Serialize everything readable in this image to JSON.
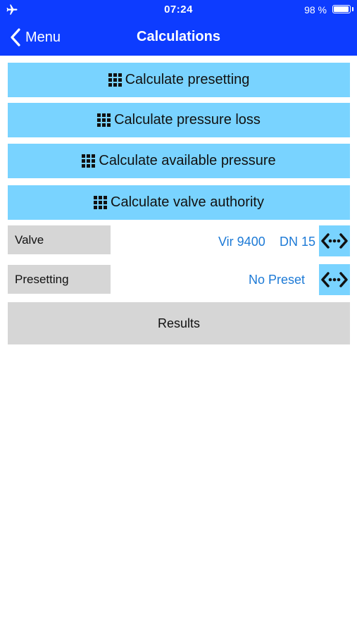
{
  "status": {
    "time": "07:24",
    "battery": "98 %",
    "battery_level": 0.98,
    "airplane_icon": "airplane-icon"
  },
  "nav": {
    "back_label": "Menu",
    "title": "Calculations",
    "back_icon": "chevron-left-icon"
  },
  "calculations": [
    {
      "label": "Calculate presetting",
      "icon": "grid-icon"
    },
    {
      "label": "Calculate pressure loss",
      "icon": "grid-icon"
    },
    {
      "label": "Calculate available pressure",
      "icon": "grid-icon"
    },
    {
      "label": "Calculate valve authority",
      "icon": "grid-icon"
    }
  ],
  "valve": {
    "label": "Valve",
    "model": "Vir 9400",
    "size": "DN 15",
    "select_icon": "double-arrow-icon"
  },
  "presetting": {
    "label": "Presetting",
    "value": "No Preset",
    "select_icon": "double-arrow-icon"
  },
  "results": {
    "label": "Results"
  },
  "colors": {
    "header_bg": "#0d3cff",
    "button_bg": "#79d3ff",
    "label_bg": "#d6d6d6",
    "link_text": "#1d7ad6"
  }
}
